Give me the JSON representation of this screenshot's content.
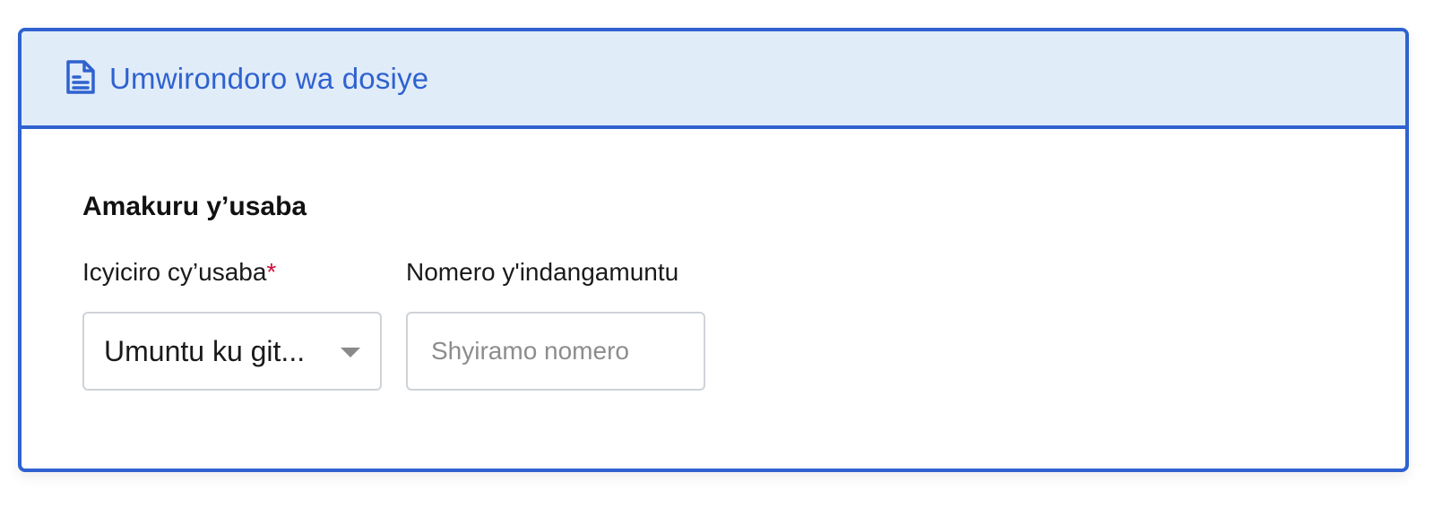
{
  "panel": {
    "title": "Umwirondoro wa dosiye",
    "icon": "document-icon",
    "accent_color": "#2f62d0",
    "header_background": "#e1ecf9"
  },
  "section": {
    "title": "Amakuru y’usaba"
  },
  "fields": {
    "category": {
      "label": "Icyiciro cy’usaba",
      "required_mark": "*",
      "value": "Umuntu ku git..."
    },
    "id_number": {
      "label": "Nomero y'indangamuntu",
      "placeholder": "Shyiramo nomero",
      "value": ""
    }
  }
}
